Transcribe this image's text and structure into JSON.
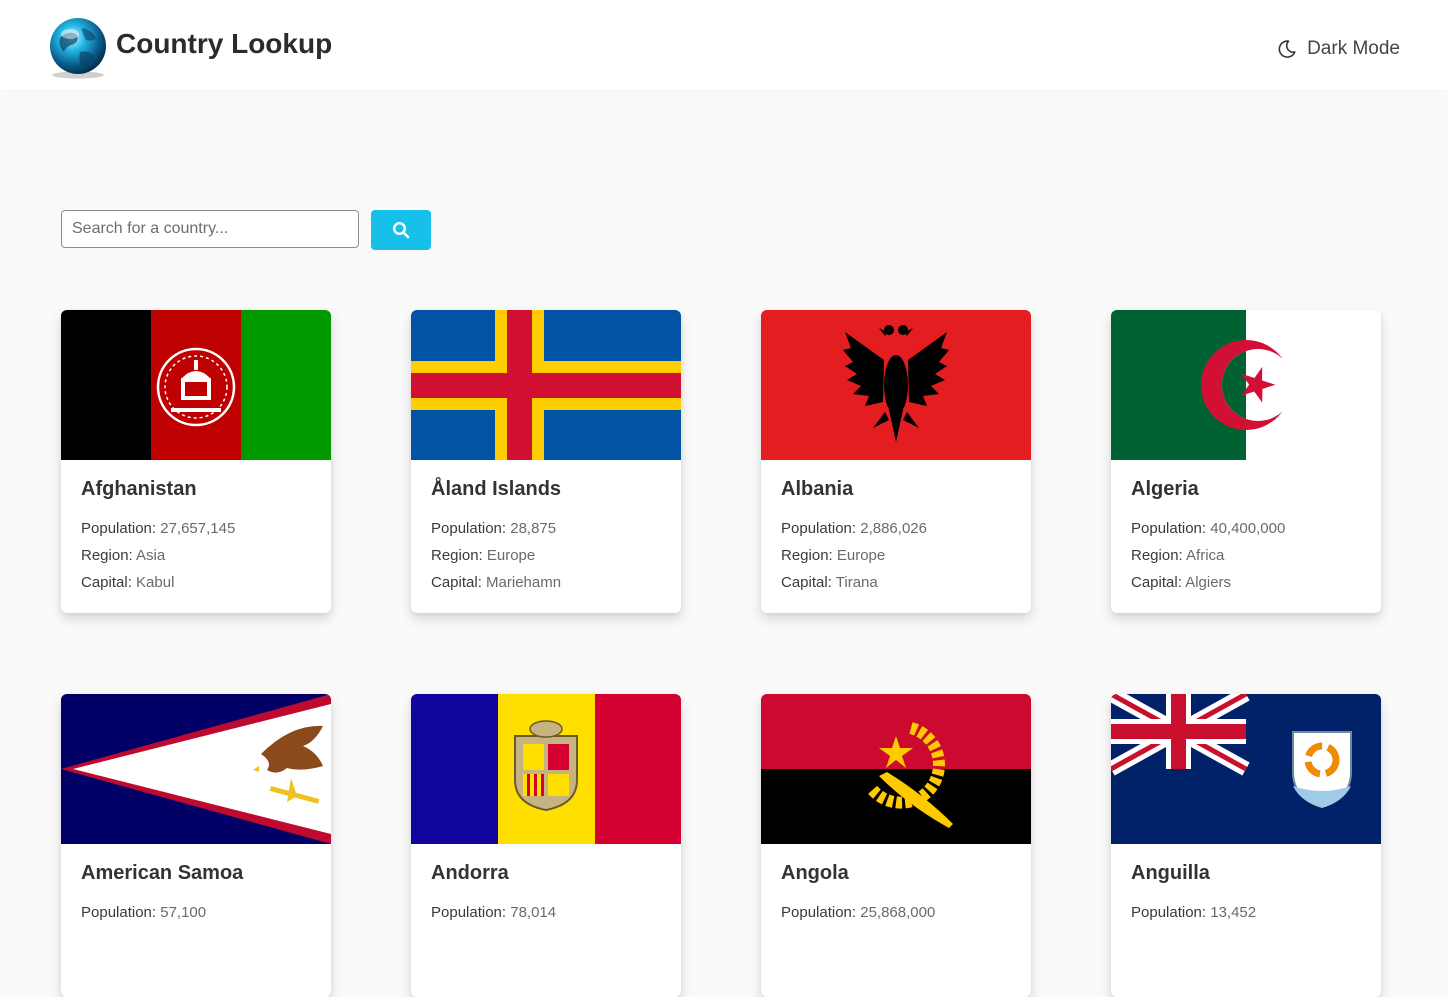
{
  "header": {
    "title": "Country Lookup",
    "dark_mode_label": "Dark Mode"
  },
  "search": {
    "placeholder": "Search for a country...",
    "value": ""
  },
  "labels": {
    "population": "Population:",
    "region": "Region:",
    "capital": "Capital:"
  },
  "colors": {
    "accent": "#17c0e8",
    "page_bg": "#fafafa"
  },
  "countries": [
    {
      "name": "Afghanistan",
      "population": "27,657,145",
      "region": "Asia",
      "capital": "Kabul"
    },
    {
      "name": "Åland Islands",
      "population": "28,875",
      "region": "Europe",
      "capital": "Mariehamn"
    },
    {
      "name": "Albania",
      "population": "2,886,026",
      "region": "Europe",
      "capital": "Tirana"
    },
    {
      "name": "Algeria",
      "population": "40,400,000",
      "region": "Africa",
      "capital": "Algiers"
    },
    {
      "name": "American Samoa",
      "population": "57,100"
    },
    {
      "name": "Andorra",
      "population": "78,014"
    },
    {
      "name": "Angola",
      "population": "25,868,000"
    },
    {
      "name": "Anguilla",
      "population": "13,452"
    }
  ]
}
